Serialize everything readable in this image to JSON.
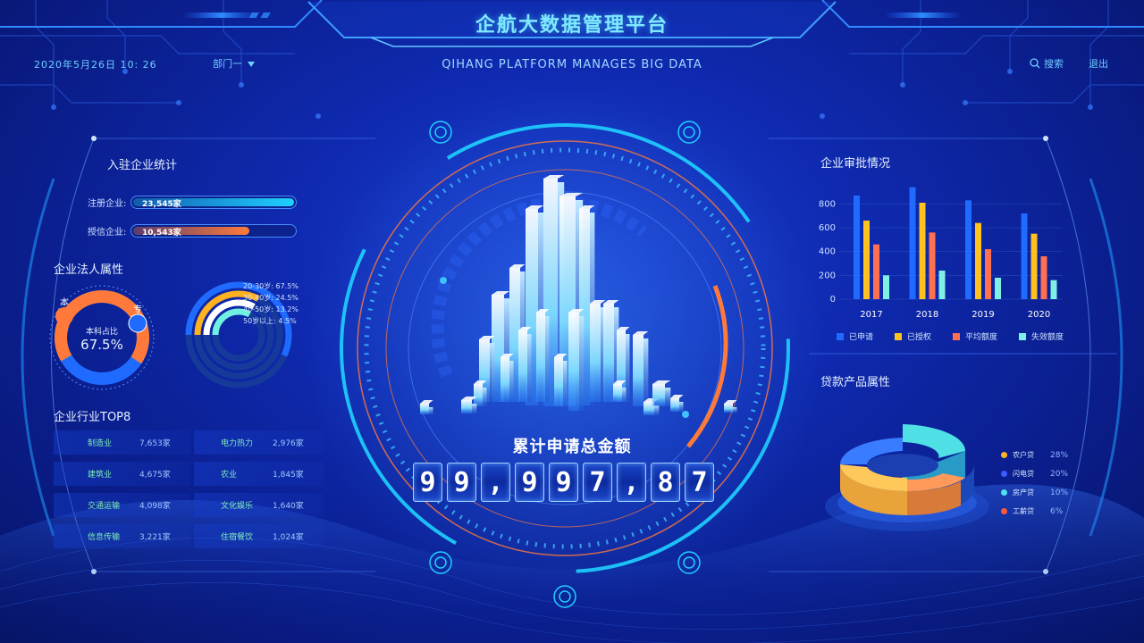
{
  "header": {
    "title": "企航大数据管理平台",
    "subtitle": "QIHANG PLATFORM MANAGES BIG DATA",
    "datetime": "2020年5月26日  10: 26",
    "department": "部门一",
    "search_label": "搜索",
    "logout_label": "退出"
  },
  "left": {
    "enterprise_stats": {
      "title": "入驻企业统计",
      "rows": [
        {
          "label": "注册企业:",
          "value": "23,545家",
          "fraction": 1.0,
          "color": "#1fd0ff"
        },
        {
          "label": "授信企业:",
          "value": "10,543家",
          "fraction": 0.72,
          "color": "#ff7a3a"
        }
      ]
    },
    "legal_person": {
      "title": "企业法人属性",
      "donut": {
        "center_label": "本科占比",
        "center_value": "67.5%",
        "badge_a": "本",
        "badge_b": "专",
        "fraction": 0.675,
        "colors": {
          "a": "#ff7a3a",
          "b": "#1f6bff"
        }
      },
      "age_rings": [
        {
          "label": "20-30岁: 67.5%",
          "fraction": 0.675,
          "color": "#1f6bff"
        },
        {
          "label": "30-40岁: 24.5%",
          "fraction": 0.245,
          "color": "#ffb21f"
        },
        {
          "label": "40-50岁: 13.2%",
          "fraction": 0.132,
          "color": "#ffffff"
        },
        {
          "label": "50岁以上: 4.5%",
          "fraction": 0.045,
          "color": "#6ff0e0"
        }
      ]
    },
    "industry_top8": {
      "title": "企业行业TOP8",
      "rows": [
        [
          {
            "name": "制造业",
            "value": "7,653家"
          },
          {
            "name": "电力热力",
            "value": "2,976家"
          }
        ],
        [
          {
            "name": "建筑业",
            "value": "4,675家"
          },
          {
            "name": "农业",
            "value": "1,845家"
          }
        ],
        [
          {
            "name": "交通运输",
            "value": "4,098家"
          },
          {
            "name": "文化娱乐",
            "value": "1,640家"
          }
        ],
        [
          {
            "name": "信息传输",
            "value": "3,221家"
          },
          {
            "name": "住宿餐饮",
            "value": "1,024家"
          }
        ]
      ]
    }
  },
  "center": {
    "total_label": "累计申请总金额",
    "digits": [
      "9",
      "9",
      ",",
      "9",
      "9",
      "7",
      ",",
      "8",
      "7"
    ]
  },
  "right": {
    "approval_title": "企业审批情况",
    "loan_title": "贷款产品属性",
    "pie_legend": [
      {
        "name": "农户贷",
        "pct": "28%",
        "color": "#ffb21f"
      },
      {
        "name": "闪电贷",
        "pct": "20%",
        "color": "#3a5bff"
      },
      {
        "name": "房产贷",
        "pct": "10%",
        "color": "#4fe0f0"
      },
      {
        "name": "工薪贷",
        "pct": "6%",
        "color": "#ff5a3a"
      }
    ]
  },
  "chart_data": {
    "type": "bar",
    "categories": [
      "2017",
      "2018",
      "2019",
      "2020"
    ],
    "series": [
      {
        "name": "已申请",
        "values": [
          870,
          940,
          830,
          720
        ],
        "color": "#1f6bff"
      },
      {
        "name": "已授权",
        "values": [
          660,
          810,
          640,
          550
        ],
        "color": "#ffc21f"
      },
      {
        "name": "平均额度",
        "values": [
          460,
          560,
          420,
          360
        ],
        "color": "#ff7050"
      },
      {
        "name": "失效额度",
        "values": [
          200,
          240,
          180,
          160
        ],
        "color": "#7ff0e6"
      }
    ],
    "yticks": [
      0,
      200,
      400,
      600,
      800
    ],
    "ylim": [
      0,
      900
    ]
  }
}
